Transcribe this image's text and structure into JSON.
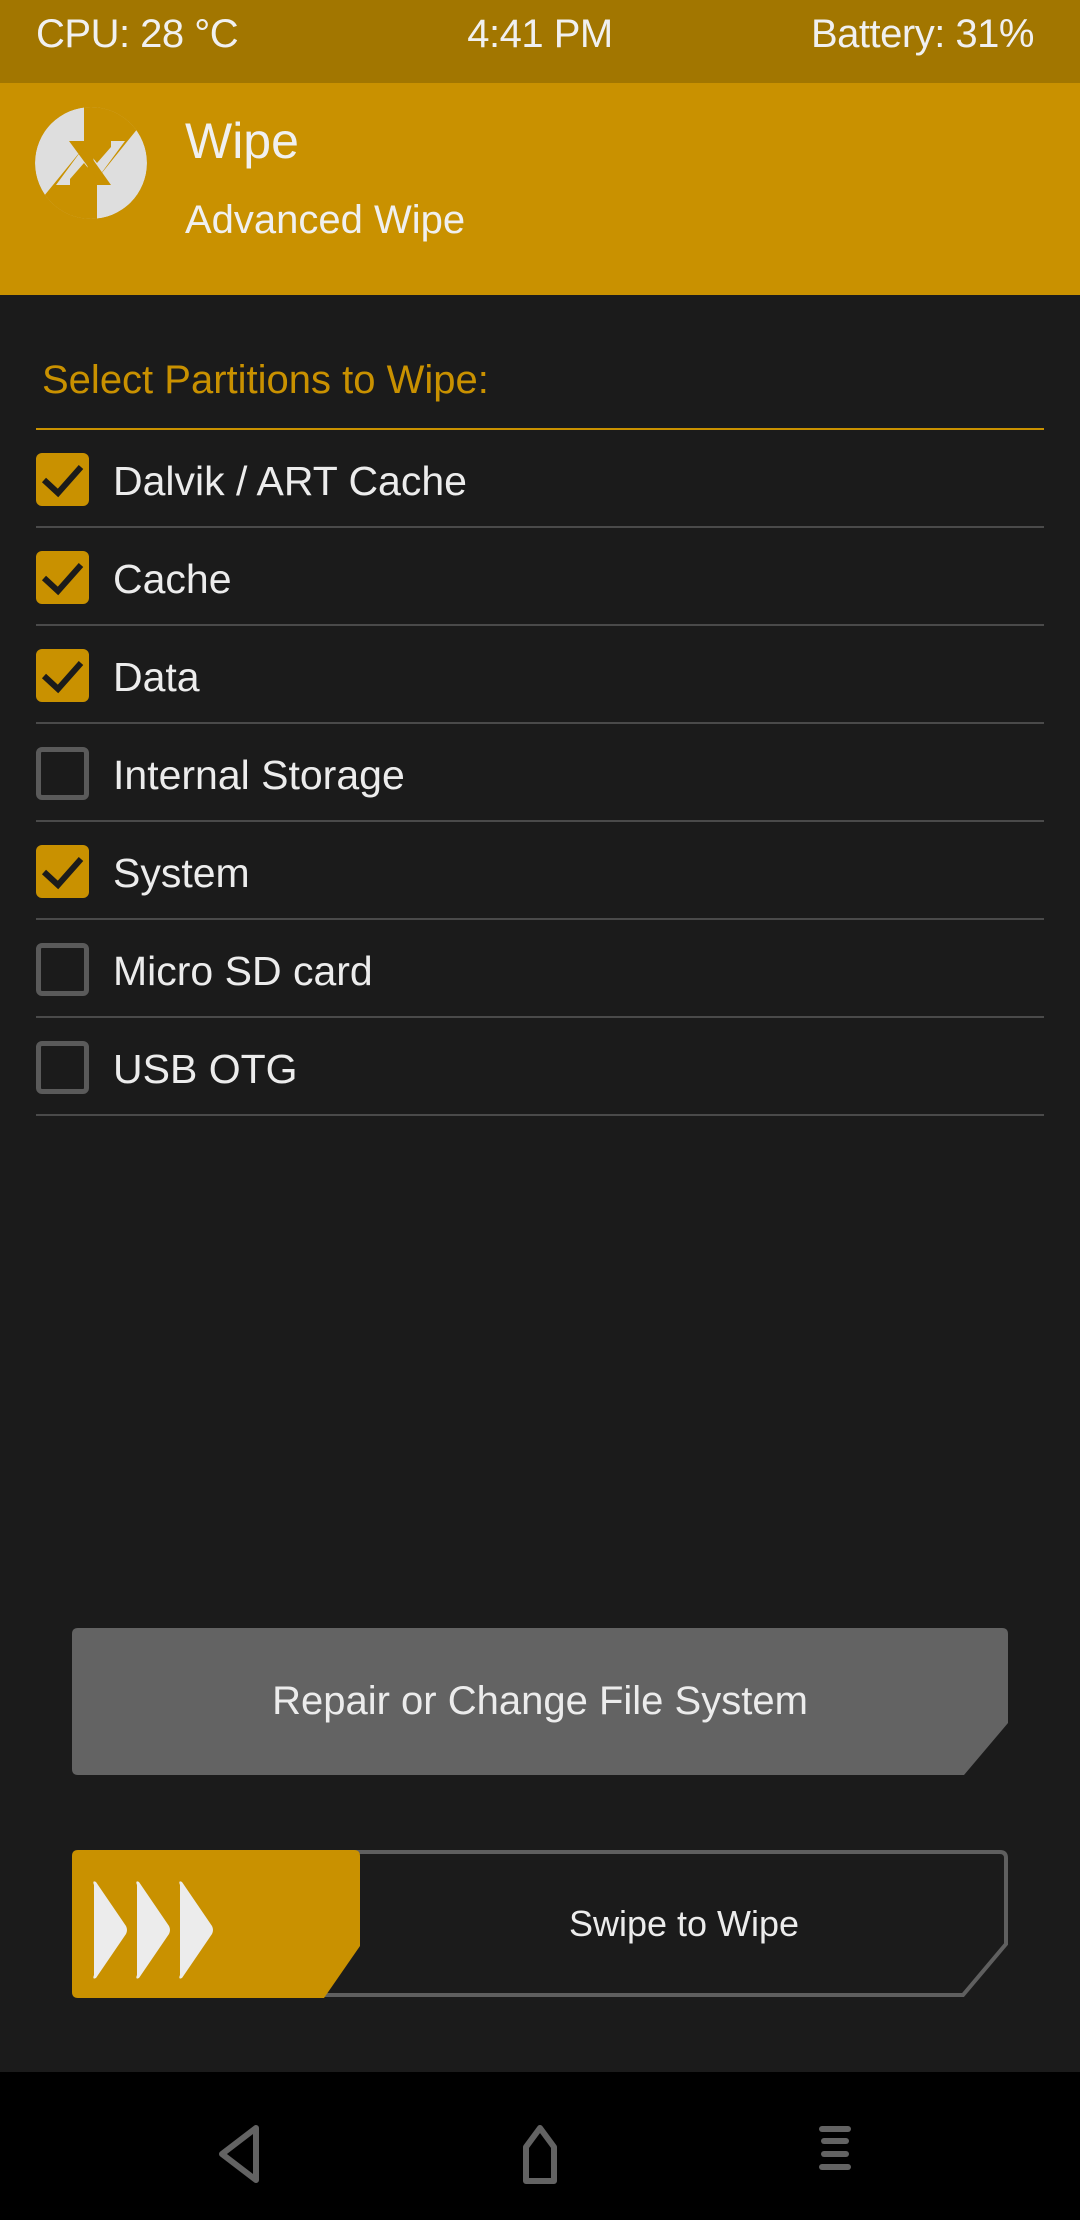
{
  "status_bar": {
    "cpu": "CPU: 28 °C",
    "time": "4:41 PM",
    "battery": "Battery: 31%"
  },
  "header": {
    "logo_icon": "twrp-logo-icon",
    "title": "Wipe",
    "subtitle": "Advanced Wipe"
  },
  "section": {
    "title": "Select Partitions to Wipe:"
  },
  "partitions": [
    {
      "label": "Dalvik / ART Cache",
      "checked": true
    },
    {
      "label": "Cache",
      "checked": true
    },
    {
      "label": "Data",
      "checked": true
    },
    {
      "label": "Internal Storage",
      "checked": false
    },
    {
      "label": "System",
      "checked": true
    },
    {
      "label": "Micro SD card",
      "checked": false
    },
    {
      "label": "USB OTG",
      "checked": false
    }
  ],
  "actions": {
    "repair_label": "Repair or Change File System",
    "swipe_label": "Swipe to Wipe",
    "swipe_handle_icon": "triple-chevron-right-icon"
  },
  "nav_bar": {
    "back_icon": "back-triangle-icon",
    "home_icon": "home-icon",
    "menu_icon": "menu-lines-icon"
  },
  "colors": {
    "accent": "#c99100",
    "status_bar": "#a27600",
    "background": "#1b1b1b",
    "button_gray": "#636363",
    "separator": "#4a4a4a"
  }
}
